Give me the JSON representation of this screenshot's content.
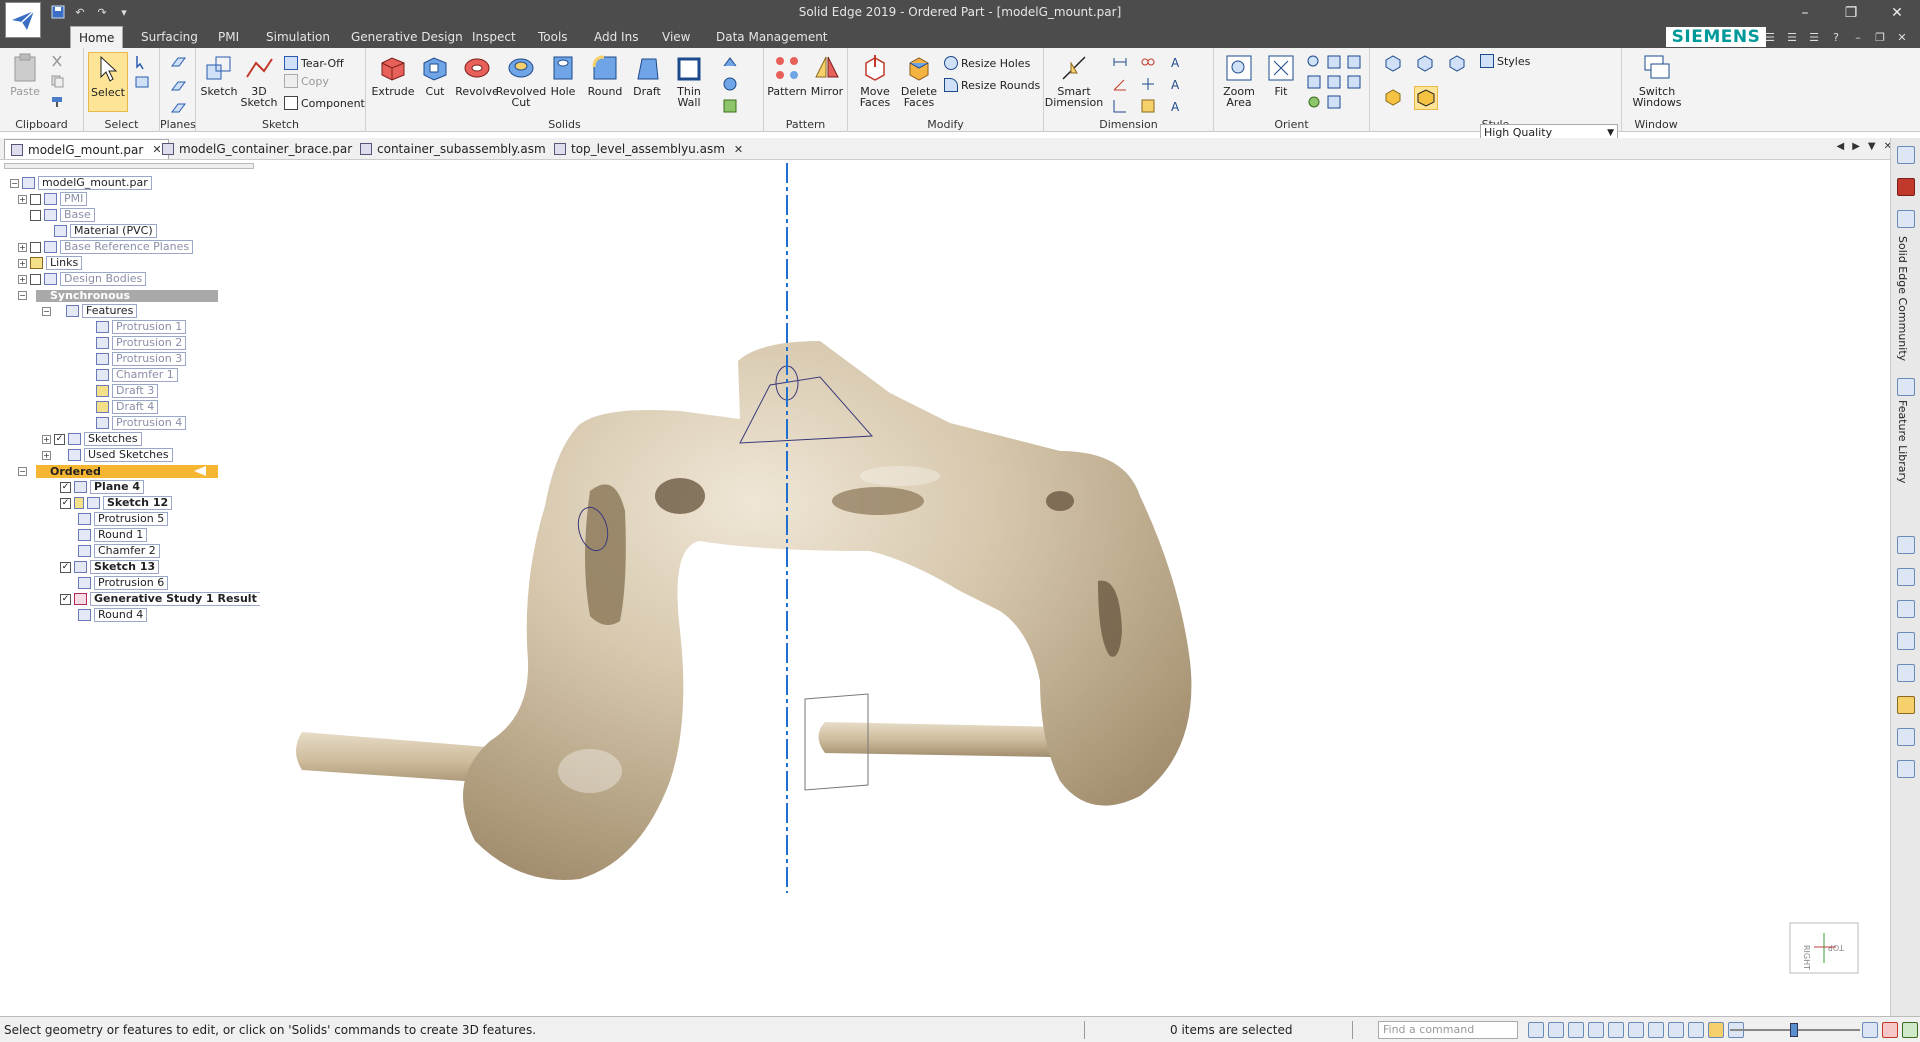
{
  "window": {
    "title": "Solid Edge 2019 - Ordered Part - [modelG_mount.par]"
  },
  "ribbon_tabs": [
    "Home",
    "Surfacing",
    "PMI",
    "Simulation",
    "Generative Design",
    "Inspect",
    "Tools",
    "Add Ins",
    "View",
    "Data Management"
  ],
  "brand": "SIEMENS",
  "ribbon": {
    "clipboard": {
      "label": "Clipboard",
      "paste": "Paste"
    },
    "select": {
      "label": "Select",
      "select": "Select"
    },
    "planes": {
      "label": "Planes"
    },
    "sketch": {
      "label": "Sketch",
      "sketch": "Sketch",
      "sketch3d_line1": "3D",
      "sketch3d_line2": "Sketch",
      "tearoff": "Tear-Off",
      "copy": "Copy",
      "component": "Component"
    },
    "solids": {
      "label": "Solids",
      "extrude": "Extrude",
      "cut": "Cut",
      "revolve": "Revolve",
      "revolved_cut_1": "Revolved",
      "revolved_cut_2": "Cut",
      "hole": "Hole",
      "round": "Round",
      "draft": "Draft",
      "thin_wall_1": "Thin",
      "thin_wall_2": "Wall"
    },
    "pattern": {
      "label": "Pattern",
      "pattern": "Pattern",
      "mirror": "Mirror"
    },
    "modify": {
      "label": "Modify",
      "move_faces_1": "Move",
      "move_faces_2": "Faces",
      "delete_faces_1": "Delete",
      "delete_faces_2": "Faces",
      "resize_holes": "Resize Holes",
      "resize_rounds": "Resize Rounds"
    },
    "dimension": {
      "label": "Dimension",
      "smart_dim_1": "Smart",
      "smart_dim_2": "Dimension"
    },
    "orient": {
      "label": "Orient",
      "zoom_area_1": "Zoom",
      "zoom_area_2": "Area",
      "fit": "Fit"
    },
    "style": {
      "label": "Style",
      "styles": "Styles",
      "quality": "High Quality"
    },
    "window": {
      "label": "Window",
      "switch_1": "Switch",
      "switch_2": "Windows"
    }
  },
  "doc_tabs": [
    "modelG_mount.par",
    "modelG_container_brace.par",
    "container_subassembly.asm",
    "top_level_assemblyu.asm"
  ],
  "tree": {
    "root": "modelG_mount.par",
    "pmi": "PMI",
    "base": "Base",
    "material": "Material (PVC)",
    "base_ref": "Base Reference Planes",
    "links": "Links",
    "design_bodies": "Design Bodies",
    "synchronous": "Synchronous",
    "features": "Features",
    "feature_items": [
      "Protrusion 1",
      "Protrusion 2",
      "Protrusion 3",
      "Chamfer 1",
      "Draft 3",
      "Draft 4",
      "Protrusion 4"
    ],
    "sketches": "Sketches",
    "used_sketches": "Used Sketches",
    "ordered": "Ordered",
    "plane4": "Plane 4",
    "sketch12": "Sketch 12",
    "protrusion5": "Protrusion 5",
    "round1": "Round 1",
    "chamfer2": "Chamfer 2",
    "sketch13": "Sketch 13",
    "protrusion6": "Protrusion 6",
    "gen_study": "Generative Study 1 Result",
    "round4": "Round 4"
  },
  "view_cube": {
    "face_right": "RIGHT",
    "face_top": "TOP"
  },
  "right_panel": {
    "community": "Solid Edge Community",
    "feature_library": "Feature Library"
  },
  "status": {
    "message": "Select geometry or features to edit, or click on 'Solids' commands to create 3D features.",
    "selection": "0 items are selected",
    "find_placeholder": "Find a command"
  }
}
